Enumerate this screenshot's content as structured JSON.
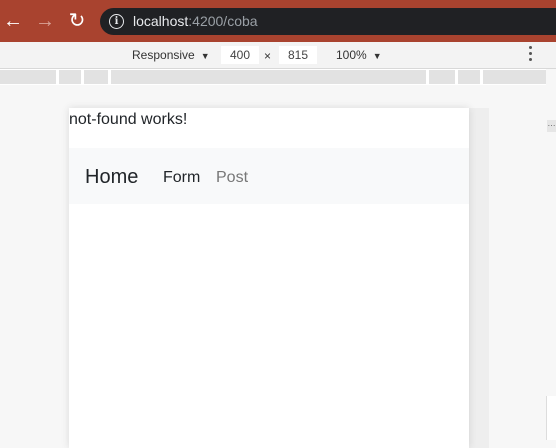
{
  "browser": {
    "url_host": "localhost",
    "url_path": ":4200/coba",
    "back_glyph": "←",
    "forward_glyph": "→",
    "reload_glyph": "↻",
    "info_glyph": "i"
  },
  "device_toolbar": {
    "device": "Responsive",
    "width": "400",
    "times": "×",
    "height": "815",
    "zoom": "100%",
    "caret": "▼"
  },
  "page": {
    "message": "not-found works!",
    "navbar": {
      "brand": "Home",
      "links": [
        {
          "label": "Form",
          "active": true
        },
        {
          "label": "Post",
          "active": false
        }
      ]
    }
  },
  "colors": {
    "browser_bar": "#a9432f",
    "omnibox": "#202124",
    "navbar_bg": "#f8f9fa"
  }
}
